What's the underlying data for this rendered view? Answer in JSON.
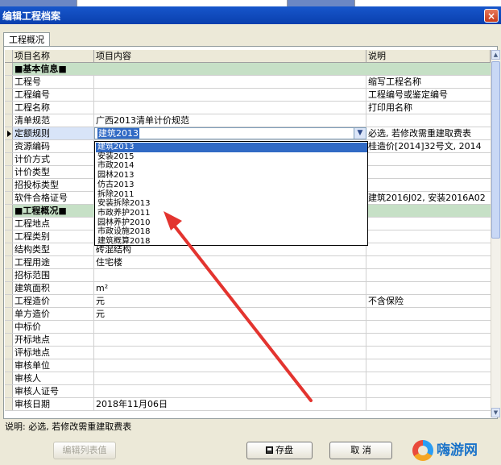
{
  "window": {
    "title": "编辑工程档案",
    "close_label": "×"
  },
  "tabs": [
    {
      "label": "工程概况"
    }
  ],
  "grid": {
    "headers": [
      "项目名称",
      "项目内容",
      "说明"
    ],
    "rows": [
      {
        "type": "section",
        "name": "■基本信息■"
      },
      {
        "name": "工程号",
        "content": "",
        "note": "缩写工程名称"
      },
      {
        "name": "工程编号",
        "content": "",
        "note": "工程编号或鉴定编号"
      },
      {
        "name": "工程名称",
        "content": "",
        "note": "打印用名称"
      },
      {
        "name": "清单规范",
        "content": "广西2013清单计价规范",
        "note": ""
      },
      {
        "name": "定额规则",
        "content": "建筑2013",
        "note": "必选, 若修改需重建取费表",
        "current": true
      },
      {
        "name": "资源编码",
        "content": "",
        "note": "桂造价[2014]32号文, 2014"
      },
      {
        "name": "计价方式",
        "content": "",
        "note": ""
      },
      {
        "name": "计价类型",
        "content": "",
        "note": ""
      },
      {
        "name": "招投标类型",
        "content": "",
        "note": ""
      },
      {
        "name": "软件合格证号",
        "content": "",
        "note": "建筑2016J02, 安装2016A02"
      },
      {
        "type": "section",
        "name": "■工程概况■"
      },
      {
        "name": "工程地点",
        "content": "",
        "note": ""
      },
      {
        "name": "工程类别",
        "content": "",
        "note": ""
      },
      {
        "name": "结构类型",
        "content": "砖混结构",
        "note": ""
      },
      {
        "name": "工程用途",
        "content": "住宅楼",
        "note": ""
      },
      {
        "name": "招标范围",
        "content": "",
        "note": ""
      },
      {
        "name": "建筑面积",
        "content": "m²",
        "note": ""
      },
      {
        "name": "工程造价",
        "content": "元",
        "note": "不含保险"
      },
      {
        "name": "单方造价",
        "content": "元",
        "note": ""
      },
      {
        "name": "中标价",
        "content": "",
        "note": ""
      },
      {
        "name": "开标地点",
        "content": "",
        "note": ""
      },
      {
        "name": "评标地点",
        "content": "",
        "note": ""
      },
      {
        "name": "审核单位",
        "content": "",
        "note": ""
      },
      {
        "name": "审核人",
        "content": "",
        "note": ""
      },
      {
        "name": "审核人证号",
        "content": "",
        "note": ""
      },
      {
        "name": "审核日期",
        "content": "2018年11月06日",
        "note": ""
      }
    ]
  },
  "dropdown": {
    "current_value": "建筑2013",
    "options": [
      "建筑2013",
      "安装2015",
      "市政2014",
      "园林2013",
      "仿古2013",
      "拆除2011",
      "安装拆除2013",
      "市政养护2011",
      "园林养护2010",
      "市政设施2018",
      "建筑概算2018"
    ],
    "selected_index": 0
  },
  "status": {
    "text": "说明: 必选, 若修改需重建取费表"
  },
  "buttons": {
    "edit_list": "编辑列表值",
    "save": "存盘",
    "cancel": "取 消"
  },
  "watermark": {
    "text": "嗨游网"
  },
  "colors": {
    "section_bg": "#c6e0c6",
    "selection": "#316ac5",
    "annotation_arrow": "#e3342f",
    "title_bar": "#0a3fae"
  }
}
